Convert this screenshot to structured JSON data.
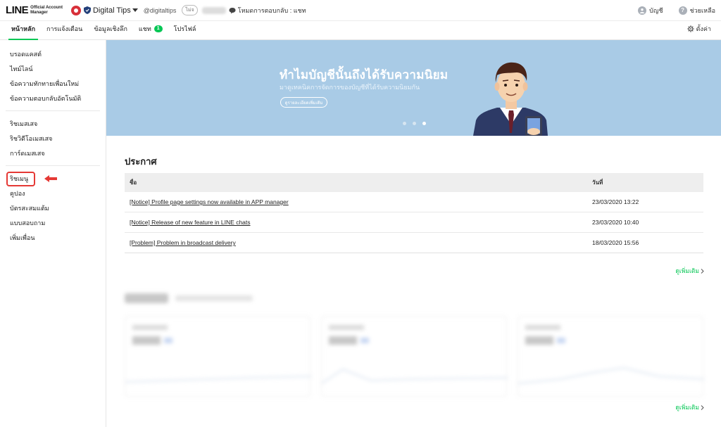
{
  "header": {
    "logo_main": "LINE",
    "logo_sub_1": "Official Account",
    "logo_sub_2": "Manager",
    "account_name": "Digital Tips",
    "account_id": "@digitaltips",
    "plan_badge": "ไม่จ",
    "mode_text": "โหมดการตอบกลับ : แชท",
    "account_label": "บัญชี",
    "help_label": "ช่วยเหลือ"
  },
  "nav": {
    "tabs": [
      {
        "label": "หน้าหลัก"
      },
      {
        "label": "การแจ้งเตือน"
      },
      {
        "label": "ข้อมูลเชิงลึก"
      },
      {
        "label": "แชท",
        "count": "1"
      },
      {
        "label": "โปรไฟล์"
      }
    ],
    "settings_label": "ตั้งค่า"
  },
  "sidebar": {
    "group1": [
      "บรอดแคสต์",
      "ไทม์ไลน์",
      "ข้อความทักทายเพื่อนใหม่",
      "ข้อความตอบกลับอัตโนมัติ"
    ],
    "group2": [
      "ริชเมสเสจ",
      "ริชวิดีโอเมสเสจ",
      "การ์ดเมสเสจ"
    ],
    "group3": [
      "ริชเมนู",
      "คูปอง",
      "บัตรสะสมแต้ม",
      "แบบสอบถาม",
      "เพิ่มเพื่อน"
    ]
  },
  "banner": {
    "title": "ทำไมบัญชีนั้นถึงได้รับความนิยม",
    "subtitle": "มาดูเทคนิคการจัดการของบัญชีที่ได้รับความนิยมกัน",
    "button_label": "ดูรายละเอียดเพิ่มเติม"
  },
  "announcements": {
    "title": "ประกาศ",
    "col_name": "ชื่อ",
    "col_date": "วันที่",
    "rows": [
      {
        "name": "[Notice] Profile page settings now available in APP manager",
        "date": "23/03/2020 13:22"
      },
      {
        "name": "[Notice] Release of new feature in LINE chats",
        "date": "23/03/2020 10:40"
      },
      {
        "name": "[Problem] Problem in broadcast delivery",
        "date": "18/03/2020 15:56"
      }
    ],
    "more_label": "ดูเพิ่มเติม"
  },
  "insights": {
    "more_label": "ดูเพิ่มเติม"
  },
  "colors": {
    "accent": "#06c755",
    "banner_bg": "#a9cbe6",
    "highlight": "#e53935"
  }
}
